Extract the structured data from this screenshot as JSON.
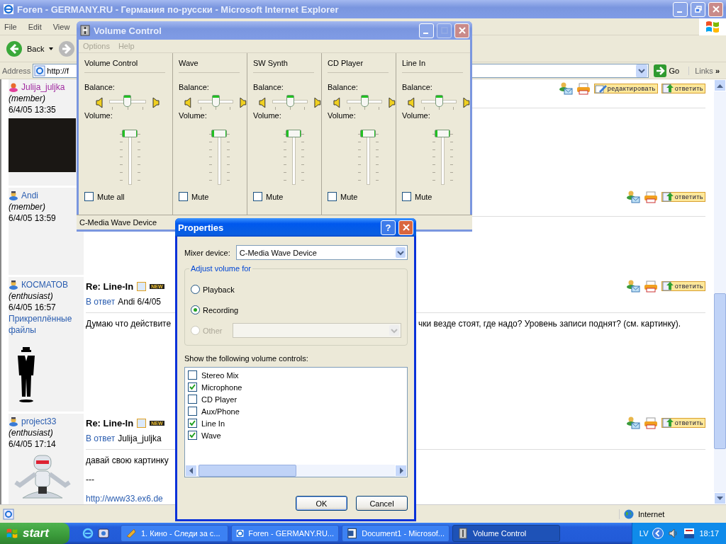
{
  "ie": {
    "title": "Foren - GERMANY.RU - Германия по-русски - Microsoft Internet Explorer",
    "active": false,
    "menu": [
      "File",
      "Edit",
      "View"
    ],
    "back": "Back",
    "address_label": "Address",
    "address": "http://f",
    "go": "Go",
    "links": "Links",
    "links_more": "»"
  },
  "posts": [
    {
      "author": "Julija_juljka",
      "author_icon": {
        "kind": "female"
      },
      "visited": true,
      "role": "(member)",
      "date": "6/4/05 13:35",
      "avatar": {
        "kind": "photo"
      },
      "actions": [
        {
          "kind": "mail"
        },
        {
          "kind": "print"
        },
        {
          "kind": "edit",
          "label": "редактировать"
        },
        {
          "kind": "reply",
          "label": "ответить"
        }
      ]
    },
    {
      "author": "Andi",
      "author_icon": {
        "kind": "male"
      },
      "visited": false,
      "role": "(member)",
      "date": "6/4/05 13:59",
      "actions": [
        {
          "kind": "mail"
        },
        {
          "kind": "print"
        },
        {
          "kind": "reply",
          "label": "ответить"
        }
      ]
    },
    {
      "author": "КОСМАТОВ",
      "author_icon": {
        "kind": "male"
      },
      "visited": false,
      "role": "(enthusiast)",
      "date": "6/4/05 16:57",
      "attachments": "Прикреплённые файлы",
      "avatar": {
        "kind": "suit"
      },
      "title": "Re: Line-In",
      "badge": "NEW",
      "reply_link": "В ответ",
      "reply_text": "Andi 6/4/05",
      "actions": [
        {
          "kind": "mail"
        },
        {
          "kind": "print"
        },
        {
          "kind": "reply",
          "label": "ответить"
        }
      ],
      "body": [
        {
          "kind": "text",
          "left": "Думаю что действите",
          "right": "чки везде стоят, где надо? Уровень записи поднят? (см. картинку)."
        }
      ]
    },
    {
      "author": "project33",
      "author_icon": {
        "kind": "male"
      },
      "visited": false,
      "role": "(enthusiast)",
      "date": "6/4/05 17:14",
      "avatar": {
        "kind": "robot"
      },
      "title": "Re: Line-In",
      "badge": "NEW",
      "reply_link": "В ответ",
      "reply_text": "Julija_juljka",
      "actions": [
        {
          "kind": "mail"
        },
        {
          "kind": "print"
        },
        {
          "kind": "reply",
          "label": "ответить"
        }
      ],
      "body": [
        {
          "kind": "text",
          "left": "давай свою картинку"
        },
        {
          "kind": "text",
          "left": "---"
        },
        {
          "kind": "link",
          "left": "http://www33.ex6.de"
        }
      ]
    }
  ],
  "status_bar": {
    "zone": "Internet"
  },
  "volume_control": {
    "title": "Volume Control",
    "active": false,
    "menu": [
      {
        "label": "Options",
        "disabled": true
      },
      {
        "label": "Help",
        "disabled": true
      }
    ],
    "channels": [
      {
        "name": "Volume Control",
        "balance_label": "Balance:",
        "balance": {
          "level": 0.5
        },
        "volume_label": "Volume:",
        "volume": {
          "level": 1
        },
        "mute_label": "Mute all",
        "muted": false
      },
      {
        "name": "Wave",
        "balance_label": "Balance:",
        "balance": {
          "level": 0.5
        },
        "volume_label": "Volume:",
        "volume": {
          "level": 1
        },
        "mute_label": "Mute",
        "muted": false
      },
      {
        "name": "SW Synth",
        "balance_label": "Balance:",
        "balance": {
          "level": 0.5
        },
        "volume_label": "Volume:",
        "volume": {
          "level": 1
        },
        "mute_label": "Mute",
        "muted": false
      },
      {
        "name": "CD Player",
        "balance_label": "Balance:",
        "balance": {
          "level": 0.5
        },
        "volume_label": "Volume:",
        "volume": {
          "level": 1
        },
        "mute_label": "Mute",
        "muted": false
      },
      {
        "name": "Line In",
        "balance_label": "Balance:",
        "balance": {
          "level": 0.5
        },
        "volume_label": "Volume:",
        "volume": {
          "level": 1
        },
        "mute_label": "Mute",
        "muted": false
      }
    ],
    "status": "C-Media Wave Device"
  },
  "properties": {
    "title": "Properties",
    "active": true,
    "help": "?",
    "mixer_label": "Mixer device:",
    "mixer_value": "C-Media Wave Device",
    "group_label": "Adjust volume for",
    "options": [
      {
        "label": "Playback",
        "selected": false,
        "disabled": false
      },
      {
        "label": "Recording",
        "selected": true,
        "disabled": false
      },
      {
        "label": "Other",
        "selected": false,
        "disabled": true
      }
    ],
    "list_label": "Show the following volume controls:",
    "controls": [
      {
        "label": "Stereo Mix",
        "checked": false
      },
      {
        "label": "Microphone",
        "checked": true
      },
      {
        "label": "CD Player",
        "checked": false
      },
      {
        "label": "Aux/Phone",
        "checked": false
      },
      {
        "label": "Line In",
        "checked": true
      },
      {
        "label": "Wave",
        "checked": true
      }
    ],
    "buttons": [
      {
        "label": "OK",
        "default": true
      },
      {
        "label": "Cancel",
        "default": false
      }
    ]
  },
  "taskbar": {
    "start": "start",
    "items": [
      {
        "label": "1. Кино - Следи за с...",
        "kind": "player",
        "selected": false
      },
      {
        "label": "Foren - GERMANY.RU...",
        "kind": "browser",
        "selected": false
      },
      {
        "label": "Document1 - Microsof...",
        "kind": "document",
        "selected": false
      },
      {
        "label": "Volume Control",
        "kind": "volume",
        "selected": true
      }
    ],
    "language": "LV",
    "time": "18:17"
  }
}
